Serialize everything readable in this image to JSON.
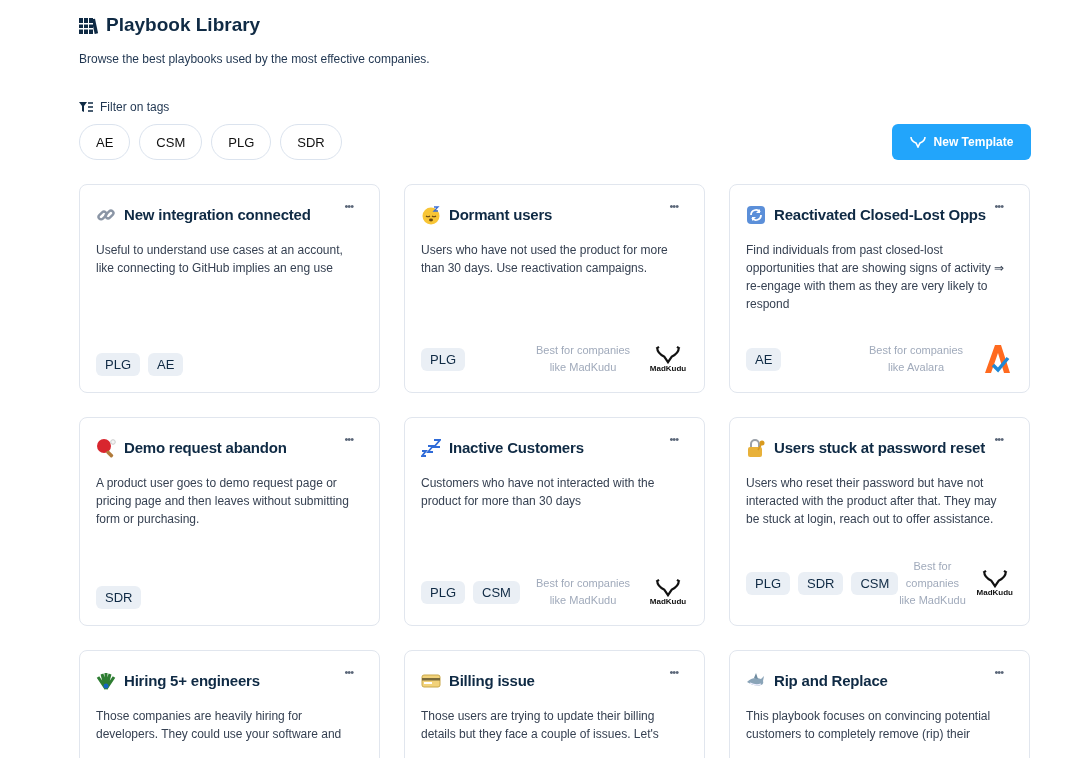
{
  "header": {
    "title": "Playbook Library",
    "subtitle": "Browse the best playbooks used by the most effective companies."
  },
  "filter": {
    "label": "Filter on tags",
    "tags": [
      "AE",
      "CSM",
      "PLG",
      "SDR"
    ]
  },
  "new_template_button": "New Template",
  "cards": [
    {
      "title": "New integration connected",
      "menu": "•••",
      "description": "Useful to understand use cases at an account, like connecting to GitHub implies an eng use",
      "tags": [
        "PLG",
        "AE"
      ]
    },
    {
      "title": "Dormant users",
      "menu": "•••",
      "description": "Users who have not used the product for more than 30 days. Use reactivation campaigns.",
      "tags": [
        "PLG"
      ],
      "best_for": {
        "text": "Best for companies like MadKudu",
        "logo_text": "MadKudu"
      }
    },
    {
      "title": "Reactivated Closed-Lost Opps",
      "menu": "•••",
      "description": "Find individuals from past closed-lost opportunities that are showing signs of activity ⇒ re-engage with them as they are very likely to respond",
      "tags": [
        "AE"
      ],
      "best_for": {
        "text": "Best for companies like Avalara"
      }
    },
    {
      "title": "Demo request abandon",
      "menu": "•••",
      "description": "A product user goes to demo request page or pricing page and then leaves without submitting form or purchasing.",
      "tags": [
        "SDR"
      ]
    },
    {
      "title": "Inactive Customers",
      "menu": "•••",
      "description": "Customers who have not interacted with the product for more than 30 days",
      "tags": [
        "PLG",
        "CSM"
      ],
      "best_for": {
        "text": "Best for companies like MadKudu",
        "logo_text": "MadKudu"
      }
    },
    {
      "title": "Users stuck at password reset",
      "menu": "•••",
      "description": "Users who reset their password but have not interacted with the product after that. They may be stuck at login, reach out to offer assistance.",
      "tags": [
        "PLG",
        "SDR",
        "CSM"
      ],
      "best_for": {
        "text": "Best for companies like MadKudu",
        "logo_text": "MadKudu"
      }
    },
    {
      "title": "Hiring 5+ engineers",
      "menu": "•••",
      "description": "Those companies are heavily hiring for developers. They could use your software and"
    },
    {
      "title": "Billing issue",
      "menu": "•••",
      "description": "Those users are trying to update their billing details but they face a couple of issues. Let's"
    },
    {
      "title": "Rip and Replace",
      "menu": "•••",
      "description": "This playbook focuses on convincing potential customers to completely remove (rip) their"
    }
  ]
}
